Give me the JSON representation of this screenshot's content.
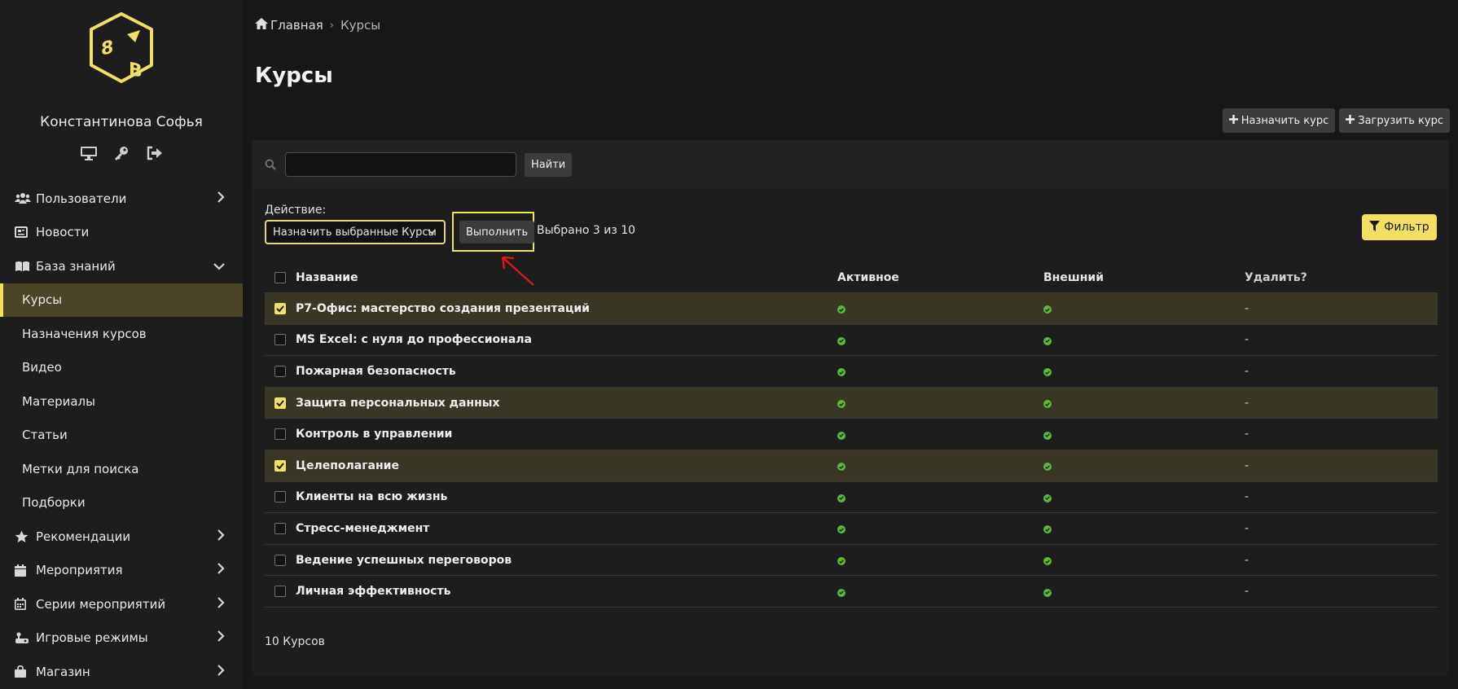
{
  "sidebar": {
    "user_name": "Константинова Софья",
    "user_icons": [
      "monitor-icon",
      "key-icon",
      "sign-out-icon"
    ],
    "items": [
      {
        "label": "Пользователи",
        "icon": "users-icon",
        "chevron": "right"
      },
      {
        "label": "Новости",
        "icon": "newspaper-icon",
        "chevron": ""
      },
      {
        "label": "База знаний",
        "icon": "book-icon",
        "chevron": "down"
      },
      {
        "label": "Курсы",
        "sub": true,
        "active": true
      },
      {
        "label": "Назначения курсов",
        "sub": true
      },
      {
        "label": "Видео",
        "sub": true
      },
      {
        "label": "Материалы",
        "sub": true
      },
      {
        "label": "Статьи",
        "sub": true
      },
      {
        "label": "Метки для поиска",
        "sub": true
      },
      {
        "label": "Подборки",
        "sub": true
      },
      {
        "label": "Рекомендации",
        "icon": "star-icon",
        "chevron": "right"
      },
      {
        "label": "Мероприятия",
        "icon": "calendar-icon",
        "chevron": "right"
      },
      {
        "label": "Серии мероприятий",
        "icon": "calendar-grid-icon",
        "chevron": "right"
      },
      {
        "label": "Игровые режимы",
        "icon": "gamepad-icon",
        "chevron": "right"
      },
      {
        "label": "Магазин",
        "icon": "bag-icon",
        "chevron": "right"
      }
    ]
  },
  "breadcrumb": {
    "home": "Главная",
    "separator": "›",
    "current": "Курсы"
  },
  "page_title": "Курсы",
  "actions": {
    "assign": "Назначить курс",
    "upload": "Загрузить курс"
  },
  "search": {
    "value": "",
    "button": "Найти"
  },
  "bulk": {
    "label": "Действие:",
    "selected_action": "Назначить выбранные Курсы",
    "execute": "Выполнить",
    "selected_info": "Выбрано 3 из 10"
  },
  "filter_label": "Фильтр",
  "table": {
    "headers": {
      "name": "Название",
      "active": "Активное",
      "external": "Внешний",
      "delete": "Удалить?"
    },
    "rows": [
      {
        "name": "Р7-Офис: мастерство создания презентаций",
        "checked": true,
        "active": true,
        "external": true,
        "delete": "-"
      },
      {
        "name": "MS Excel: с нуля до профессионала",
        "checked": false,
        "active": true,
        "external": true,
        "delete": "-"
      },
      {
        "name": "Пожарная безопасность",
        "checked": false,
        "active": true,
        "external": true,
        "delete": "-"
      },
      {
        "name": "Защита персональных данных",
        "checked": true,
        "active": true,
        "external": true,
        "delete": "-"
      },
      {
        "name": "Контроль в управлении",
        "checked": false,
        "active": true,
        "external": true,
        "delete": "-"
      },
      {
        "name": "Целеполагание",
        "checked": true,
        "active": true,
        "external": true,
        "delete": "-"
      },
      {
        "name": "Клиенты на всю жизнь",
        "checked": false,
        "active": true,
        "external": true,
        "delete": "-"
      },
      {
        "name": "Стресс-менеджмент",
        "checked": false,
        "active": true,
        "external": true,
        "delete": "-"
      },
      {
        "name": "Ведение успешных переговоров",
        "checked": false,
        "active": true,
        "external": true,
        "delete": "-"
      },
      {
        "name": "Личная эффективность",
        "checked": false,
        "active": true,
        "external": true,
        "delete": "-"
      }
    ]
  },
  "footer_count": "10 Курсов",
  "colors": {
    "accent": "#f3e061",
    "active_row": "#4b4428",
    "selected_row": "#3a3626",
    "ok": "#5fb832",
    "annotation": "#e8161b"
  }
}
